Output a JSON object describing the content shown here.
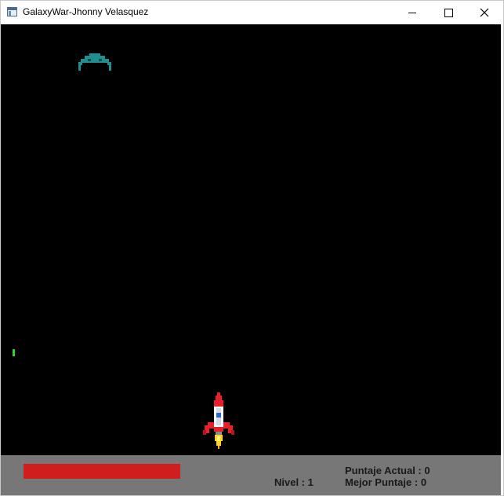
{
  "window": {
    "title": "GalaxyWar-Jhonny Velasquez",
    "icon": "app-window-icon",
    "controls": [
      "minimize-icon",
      "maximize-icon",
      "close-icon"
    ]
  },
  "game": {
    "background_color": "#000000",
    "enemy": {
      "icon": "alien-ship-icon",
      "color": "#1f8f8f"
    },
    "bullet": {
      "color": "#2fd52f"
    },
    "player": {
      "icon": "rocket-icon",
      "colors": [
        "#e8202a",
        "#ffffff",
        "#ffd12a"
      ]
    }
  },
  "hud": {
    "background_color": "#777777",
    "health_color": "#d01e1e",
    "level_label": "Nivel :",
    "level_value": "1",
    "score_label": "Puntaje Actual :",
    "score_value": "0",
    "best_label": "Mejor Puntaje :",
    "best_value": "0"
  }
}
